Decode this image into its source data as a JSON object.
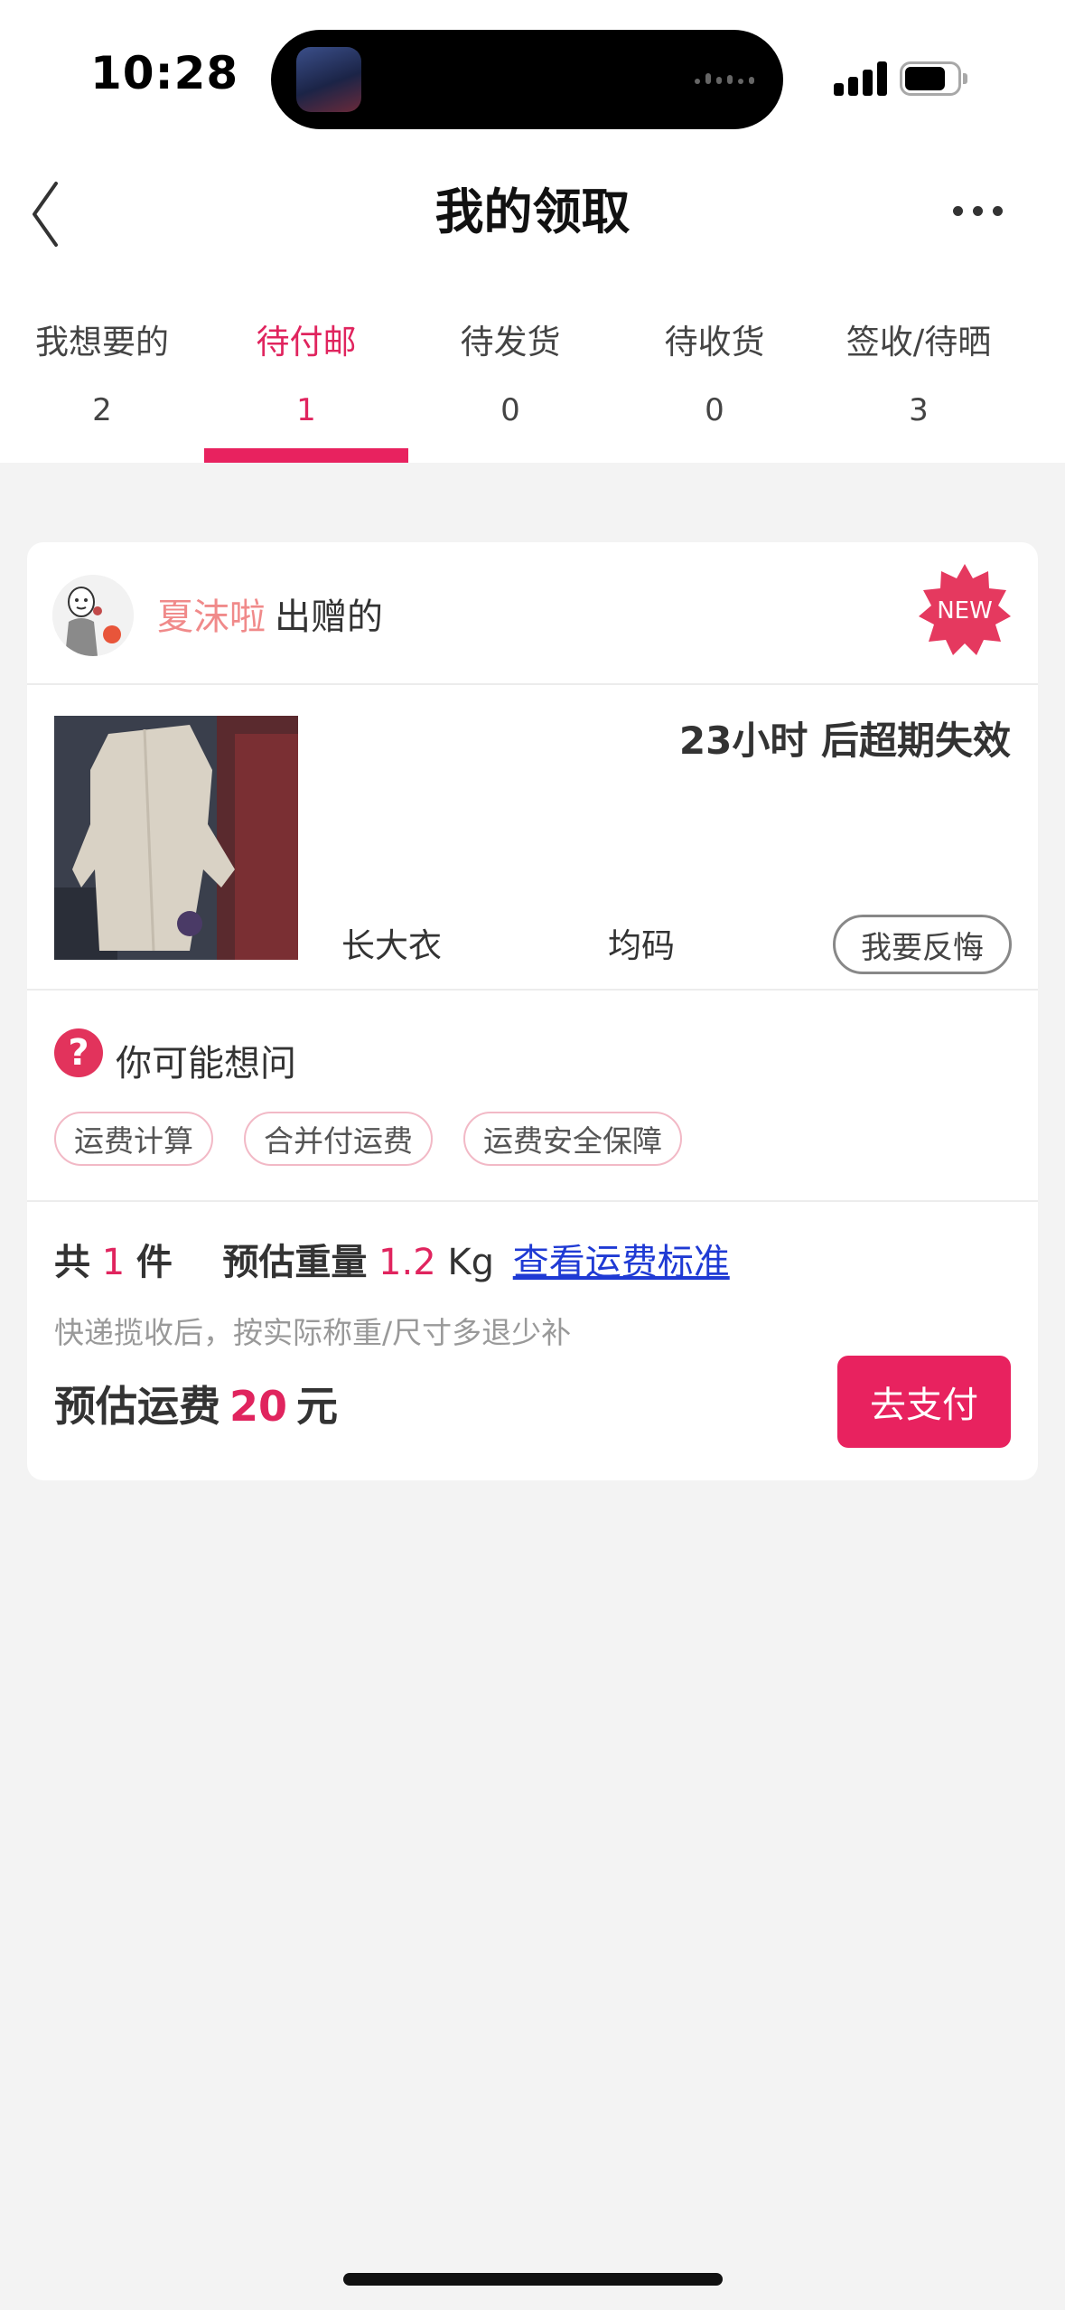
{
  "status_bar": {
    "time": "10:28"
  },
  "nav": {
    "title": "我的领取"
  },
  "tabs": [
    {
      "label": "我想要的",
      "count": "2"
    },
    {
      "label": "待付邮",
      "count": "1",
      "active": true
    },
    {
      "label": "待发货",
      "count": "0"
    },
    {
      "label": "待收货",
      "count": "0"
    },
    {
      "label": "签收/待晒",
      "count": "3"
    }
  ],
  "card": {
    "giver_name": "夏沫啦",
    "giver_suffix": "出赠的",
    "new_badge": "NEW",
    "expiry": "23小时 后超期失效",
    "item_name": "长大衣",
    "item_size": "均码",
    "regret_button": "我要反悔",
    "faq_title": "你可能想问",
    "faq_chips": [
      "运费计算",
      "合并付运费",
      "运费安全保障"
    ],
    "qty_prefix": "共",
    "qty_value": "1",
    "qty_unit": "件",
    "weight_label": "预估重量",
    "weight_value": "1.2",
    "weight_unit": "Kg",
    "fee_standard_link": "查看运费标准",
    "note": "快递揽收后，按实际称重/尺寸多退少补",
    "fee_label": "预估运费",
    "fee_amount": "20",
    "fee_unit": "元",
    "pay_button": "去支付"
  },
  "colors": {
    "accent": "#e8225f",
    "giver_name": "#f08a8a",
    "link": "#1f3ad4"
  }
}
